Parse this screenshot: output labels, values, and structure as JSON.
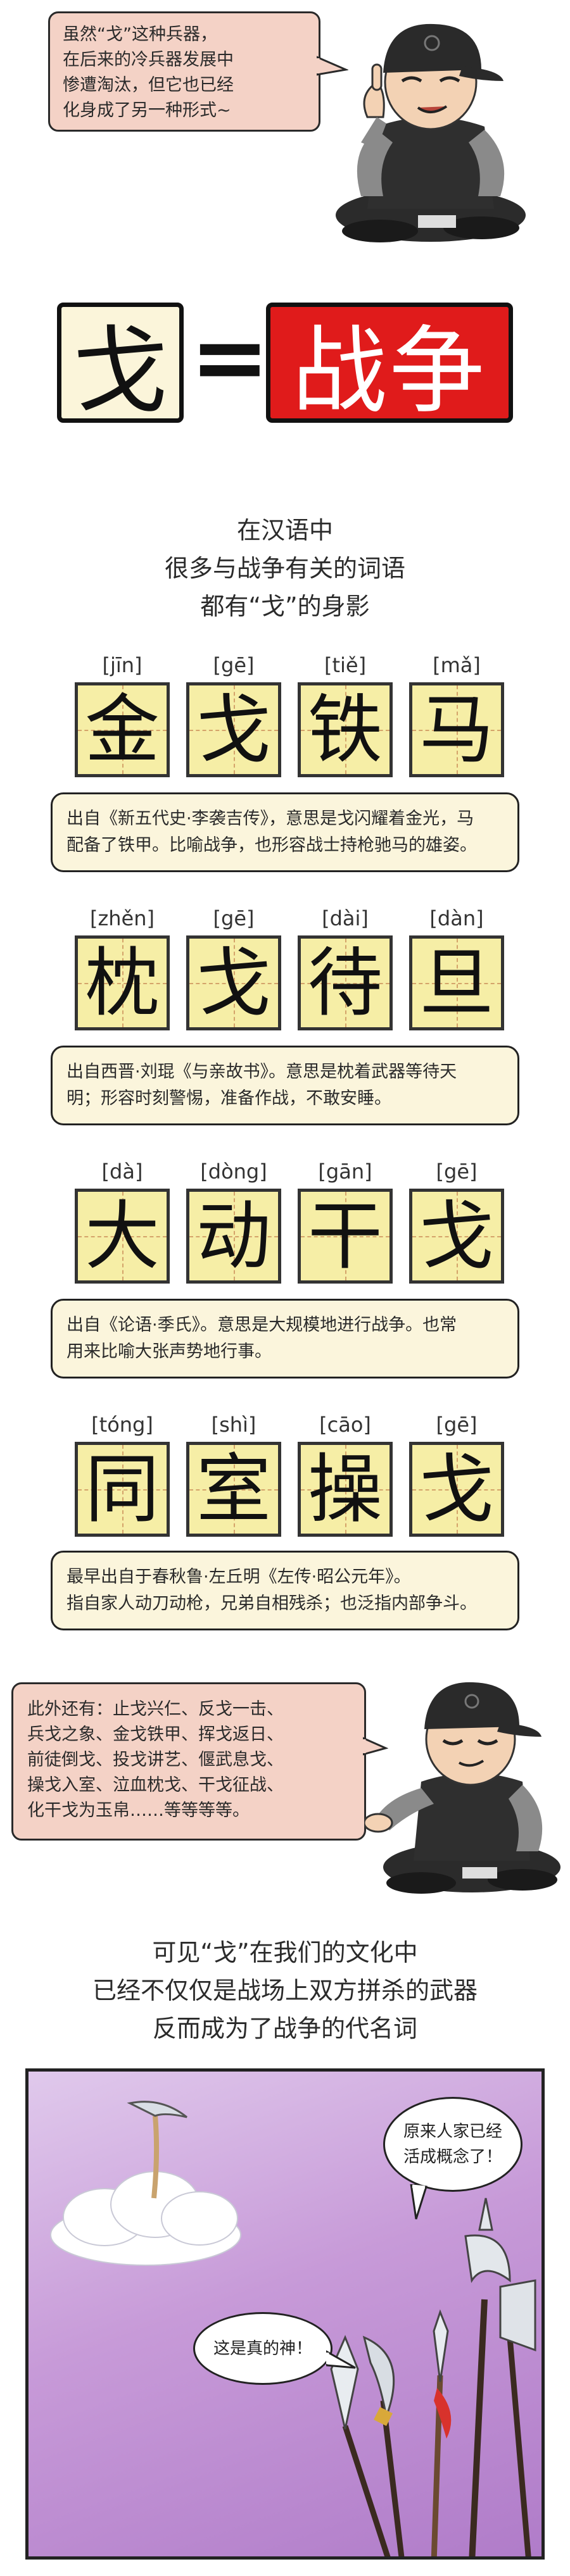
{
  "intro": {
    "bubble_lines": [
      "虽然“戈”这种兵器，",
      "在后来的冷兵器发展中",
      "惨遭淘汰，但它也已经",
      "化身成了另一种形式~"
    ]
  },
  "equation": {
    "left": "戈",
    "sign": "=",
    "right": "战争"
  },
  "lead": {
    "lines": [
      "在汉语中",
      "很多与战争有关的词语",
      "都有“戈”的身影"
    ]
  },
  "idioms": [
    {
      "pinyin": [
        "[jīn]",
        "[gē]",
        "[tiě]",
        "[mǎ]"
      ],
      "chars": [
        "金",
        "戈",
        "铁",
        "马"
      ],
      "desc": [
        "出自《新五代史·李袭吉传》，意思是戈闪耀着金光，马",
        "配备了铁甲。比喻战争，也形容战士持枪驰马的雄姿。"
      ]
    },
    {
      "pinyin": [
        "[zhěn]",
        "[gē]",
        "[dài]",
        "[dàn]"
      ],
      "chars": [
        "枕",
        "戈",
        "待",
        "旦"
      ],
      "desc": [
        "出自西晋·刘琨《与亲故书》。意思是枕着武器等待天",
        "明；形容时刻警惕，准备作战，不敢安睡。"
      ]
    },
    {
      "pinyin": [
        "[dà]",
        "[dòng]",
        "[gān]",
        "[gē]"
      ],
      "chars": [
        "大",
        "动",
        "干",
        "戈"
      ],
      "desc": [
        "出自《论语·季氏》。意思是大规模地进行战争。也常",
        "用来比喻大张声势地行事。"
      ]
    },
    {
      "pinyin": [
        "[tóng]",
        "[shì]",
        "[cāo]",
        "[gē]"
      ],
      "chars": [
        "同",
        "室",
        "操",
        "戈"
      ],
      "desc": [
        "最早出自于春秋鲁·左丘明《左传·昭公元年》。",
        "指自家人动刀动枪，兄弟自相残杀；也泛指内部争斗。"
      ]
    }
  ],
  "more": {
    "bubble_lines": [
      "此外还有：止戈兴仁、反戈一击、",
      "兵戈之象、金戈铁甲、挥戈返日、",
      "前徒倒戈、投戈讲艺、偃武息戈、",
      "操戈入室、泣血枕戈、干戈征战、",
      "化干戈为玉帛……等等等等。"
    ]
  },
  "conclusion": {
    "lines": [
      "可见“戈”在我们的文化中",
      "已经不仅仅是战场上双方拼杀的武器",
      "反而成为了战争的代名词"
    ]
  },
  "comic": {
    "bubble_right": [
      "原来人家已经",
      "活成概念了！"
    ],
    "bubble_left": "这是真的神！"
  },
  "colors": {
    "war_red": "#e01b1b",
    "tile_yellow": "#f6eea6",
    "bubble_pink": "#f4d2c6",
    "panel_purple": "#c79ad8"
  }
}
